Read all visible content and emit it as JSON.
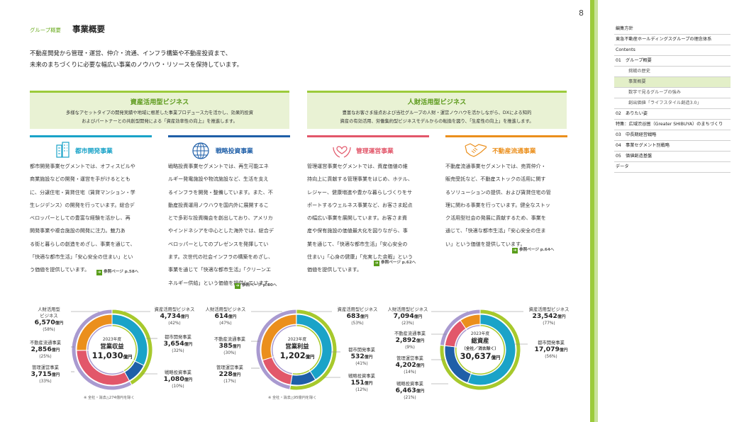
{
  "page_number": "8",
  "breadcrumb": "グループ概要",
  "page_title": "事業概要",
  "lead_lines": [
    "不動産開発から管理・運営、仲介・流通、インフラ構築や不動産投資まで、",
    "未来のまちづくりに必要な幅広い事業のノウハウ・リソースを保持しています。"
  ],
  "categories": [
    {
      "title": "資産活用型ビジネス",
      "desc": [
        "多様なアセットタイプの開発実績や地域に根差した事業プロデュース力を活かし、効果的投資",
        "およびパートナーとの共創型開発による「資産効率性の向上」を推進します。"
      ]
    },
    {
      "title": "人財活用型ビジネス",
      "desc": [
        "豊富なお客さま接点および当社グループの人財・運営ノウハウを活かしながら、DXによる知的",
        "資産の有効活用、労働集約型ビジネスモデルからの転換を図り、「生産性の向上」を推進します。"
      ]
    }
  ],
  "businesses": [
    {
      "name": "都市開発事業",
      "icon": "building-icon",
      "color": "#1aa3c8",
      "lines": [
        "都市開発事業セグメントでは、オフィスビルや",
        "商業施設などの開発・運営を手がけるととも",
        "に、分譲住宅・賃貸住宅（賃貸マンション・学",
        "生レジデンス）の開発を行っています。総合デ",
        "ベロッパーとしての豊富な経験を活かし、再",
        "開発事業や複合施設の開発に注力。魅力あ",
        "る街と暮らしの創造をめざし、事業を通じて、",
        "「快適な都市生活」「安心安全の住まい」とい",
        "う価値を提供しています。"
      ],
      "ref": "参照ページ p.58へ"
    },
    {
      "name": "戦略投資事業",
      "icon": "globe-icon",
      "color": "#1f5fa8",
      "lines": [
        "戦略投資事業セグメントでは、再生可能エネ",
        "ルギー発電施設や物流施設など、生活を支え",
        "るインフラを開発・整備しています。また、不",
        "動産投資運用ノウハウを国内外に展開するこ",
        "とで多彩な投資機会を創出しており、アメリカ",
        "やインドネシアを中心とした海外では、総合デ",
        "ベロッパーとしてのプレゼンスを発揮してい",
        "ます。次世代の社会インフラの構築をめざし、",
        "事業を通じて「快適な都市生活」「クリーンエ",
        "ネルギー供給」という価値を提供しています。"
      ],
      "ref": "参照ページ p.60へ"
    },
    {
      "name": "管理運営事業",
      "icon": "heart-hands-icon",
      "color": "#e2576a",
      "lines": [
        "管理運営事業セグメントでは、資産価値の維",
        "持向上に貢献する管理事業をはじめ、ホテル、",
        "レジャー、健康増進や豊かな暮らしづくりをサ",
        "ポートするウェルネス事業など、お客さま起点",
        "の幅広い事業を展開しています。お客さま資",
        "産や保有施設の価値最大化を図りながら、事",
        "業を通じて、「快適な都市生活」「安心安全の",
        "住まい」「心身の健康」「充実した余暇」という",
        "価値を提供しています。"
      ],
      "ref": "参照ページ p.62へ"
    },
    {
      "name": "不動産流通事業",
      "icon": "handshake-icon",
      "color": "#eb8f1c",
      "lines": [
        "不動産流通事業セグメントでは、売買仲介・",
        "販売受託など、不動産ストックの活用に関す",
        "るソリューションの提供、および賃貸住宅の管",
        "理に関わる事業を行っています。健全なストッ",
        "ク活用型社会の発展に貢献するため、事業を",
        "通じて、「快適な都市生活」「安心安全の住ま",
        "い」という価値を提供しています。"
      ],
      "ref": "参照ページ p.64へ"
    }
  ],
  "nav": [
    {
      "label": "編集方針",
      "sub": false
    },
    {
      "label": "東急不動産ホールディングスグループの理念体系",
      "sub": false
    },
    {
      "label": "Contents",
      "sub": false
    },
    {
      "label": "01　グループ概要",
      "sub": false
    },
    {
      "label": "挑戦の歴史",
      "sub": true
    },
    {
      "label": "事業概要",
      "sub": true,
      "active": true
    },
    {
      "label": "数字で見るグループの強み",
      "sub": true
    },
    {
      "label": "創出価値「ライフスタイル創造3.0」",
      "sub": true
    },
    {
      "label": "02　ありたい姿",
      "sub": false
    },
    {
      "label": "特集：広域渋谷圏（Greater SHIBUYA）のまちづくり",
      "sub": false
    },
    {
      "label": "03　中長期経営戦略",
      "sub": false
    },
    {
      "label": "04　事業セグメント別戦略",
      "sub": false
    },
    {
      "label": "05　価値創造基盤",
      "sub": false
    },
    {
      "label": "データ",
      "sub": false
    }
  ],
  "chart_data": [
    {
      "type": "pie",
      "title": "営業収益",
      "year": "2023年度",
      "total": "11,030",
      "total_unit": "億円",
      "note": "※ 全社・消去△274億円を除く",
      "outer": [
        {
          "name": "資産活用型ビジネス",
          "value": 4734
        },
        {
          "name": "人財活用型ビジネス",
          "value": 6570
        }
      ],
      "inner": [
        {
          "name": "都市開発事業",
          "value": 3654,
          "pct": "(32%)"
        },
        {
          "name": "戦略投資事業",
          "value": 1080,
          "pct": "(10%)"
        },
        {
          "name": "管理運営事業",
          "value": 3715,
          "pct": "(33%)"
        },
        {
          "name": "不動産流通事業",
          "value": 2856,
          "pct": "(25%)"
        }
      ],
      "outer_pct": [
        "(42%)",
        "(58%)"
      ]
    },
    {
      "type": "pie",
      "title": "営業利益",
      "year": "2023年度",
      "total": "1,202",
      "total_unit": "億円",
      "note": "※ 全社・消去△95億円を除く",
      "outer": [
        {
          "name": "資産活用型ビジネス",
          "value": 683
        },
        {
          "name": "人財活用型ビジネス",
          "value": 614
        }
      ],
      "inner": [
        {
          "name": "都市開発事業",
          "value": 532,
          "pct": "(41%)"
        },
        {
          "name": "戦略投資事業",
          "value": 151,
          "pct": "(12%)"
        },
        {
          "name": "管理運営事業",
          "value": 228,
          "pct": "(17%)"
        },
        {
          "name": "不動産流通事業",
          "value": 385,
          "pct": "(30%)"
        }
      ],
      "outer_pct": [
        "(53%)",
        "(47%)"
      ]
    },
    {
      "type": "pie",
      "title": "総資産",
      "subtitle": "（全社／消去除く）",
      "year": "2023年度",
      "total": "30,637",
      "total_unit": "億円",
      "note": "",
      "outer": [
        {
          "name": "資産活用型ビジネス",
          "value": 23542
        },
        {
          "name": "人財活用型ビジネス",
          "value": 7094
        }
      ],
      "inner": [
        {
          "name": "都市開発事業",
          "value": 17079,
          "pct": "(56%)"
        },
        {
          "name": "戦略投資事業",
          "value": 6463,
          "pct": "(21%)"
        },
        {
          "name": "管理運営事業",
          "value": 4202,
          "pct": "(14%)"
        },
        {
          "name": "不動産流通事業",
          "value": 2892,
          "pct": "(9%)"
        }
      ],
      "outer_pct": [
        "(77%)",
        "(23%)"
      ]
    }
  ],
  "chart_labels": {
    "c1": {
      "left_top_name": [
        "人財活用型",
        "ビジネス"
      ],
      "left_top_val": "6,570",
      "left_top_pct": "(58%)",
      "l2_name": "不動産流通事業",
      "l2_val": "2,856",
      "l2_pct": "(25%)",
      "l3_name": "管理運営事業",
      "l3_val": "3,715",
      "l3_pct": "(33%)",
      "r1_name": "資産活用型ビジネス",
      "r1_val": "4,734",
      "r1_pct": "(42%)",
      "r2_name": "都市開発事業",
      "r2_val": "3,654",
      "r2_pct": "(32%)",
      "r3_name": "戦略投資事業",
      "r3_val": "1,080",
      "r3_pct": "(10%)"
    },
    "c2": {
      "l1_name": "人財活用型ビジネス",
      "l1_val": "614",
      "l1_pct": "(47%)",
      "l2_name": "不動産流通事業",
      "l2_val": "385",
      "l2_pct": "(30%)",
      "l3_name": "管理運営事業",
      "l3_val": "228",
      "l3_pct": "(17%)",
      "r1_name": "資産活用型ビジネス",
      "r1_val": "683",
      "r1_pct": "(53%)",
      "r2_name": "都市開発事業",
      "r2_val": "532",
      "r2_pct": "(41%)",
      "r3_name": "戦略投資事業",
      "r3_val": "151",
      "r3_pct": "(12%)"
    },
    "c3": {
      "l1_name": "人財活用型ビジネス",
      "l1_val": "7,094",
      "l1_pct": "(23%)",
      "l2_name": "不動産流通事業",
      "l2_val": "2,892",
      "l2_pct": "(9%)",
      "l3_name": "管理運営事業",
      "l3_val": "4,202",
      "l3_pct": "(14%)",
      "l4_name": "戦略投資事業",
      "l4_val": "6,463",
      "l4_pct": "(21%)",
      "r1_name": "資産活用型ビジネス",
      "r1_val": "23,542",
      "r1_pct": "(77%)",
      "r2_name": "都市開発事業",
      "r2_val": "17,079",
      "r2_pct": "(56%)"
    },
    "unit": "億円"
  },
  "colors": {
    "green": "#9ccb3b",
    "city": "#1aa3c8",
    "strategy": "#1f5fa8",
    "mgmt": "#e2576a",
    "dist": "#eb8f1c",
    "asset_outer": "#1aa3c8",
    "human_outer": "#eb8f1c",
    "inner_asset": "#a7c92c",
    "inner_human": "#a99ad0"
  }
}
